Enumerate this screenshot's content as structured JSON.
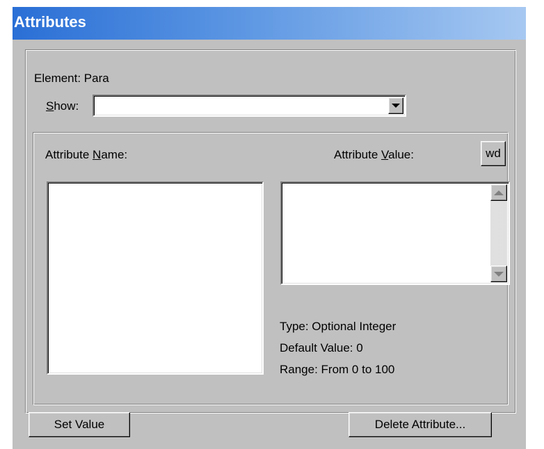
{
  "window": {
    "title": "Attributes"
  },
  "element": {
    "label": "Element: Para"
  },
  "show": {
    "label_mnemonic": "S",
    "label_rest": "how:",
    "value": ""
  },
  "attribute_name": {
    "label_pre": "Attribute ",
    "label_mnemonic": "N",
    "label_post": "ame:"
  },
  "attribute_value": {
    "label_pre": "Attribute ",
    "label_mnemonic": "V",
    "label_post": "alue:",
    "wd_button": "wd"
  },
  "info": {
    "type": "Type: Optional Integer",
    "default_value": "Default Value: 0",
    "range": "Range: From 0 to 100"
  },
  "buttons": {
    "set_value": "Set Value",
    "delete_attribute": "Delete Attribute..."
  },
  "colors": {
    "dialog_face": "#c0c0c0",
    "titlebar_start": "#2a6fd6",
    "titlebar_end": "#a6c8f1",
    "title_text": "#ffffff"
  },
  "icons": {
    "combo_arrow": "chevron-down-icon",
    "scroll_up": "scroll-up-arrow-icon",
    "scroll_down": "scroll-down-arrow-icon"
  }
}
